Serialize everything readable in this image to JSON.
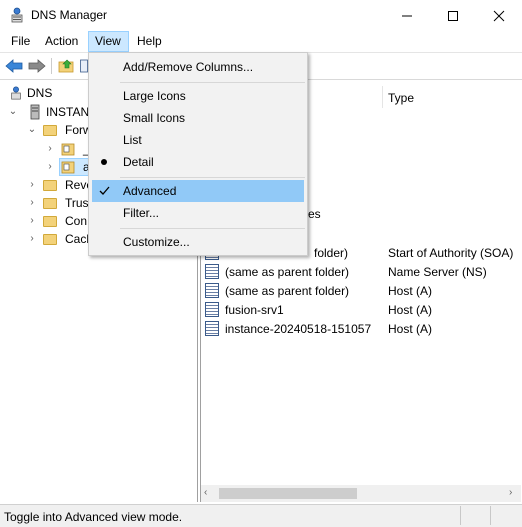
{
  "window": {
    "title": "DNS Manager"
  },
  "menubar": {
    "file": "File",
    "action": "Action",
    "view": "View",
    "help": "Help"
  },
  "view_menu": {
    "add_remove_columns": "Add/Remove Columns...",
    "large_icons": "Large Icons",
    "small_icons": "Small Icons",
    "list": "List",
    "detail": "Detail",
    "advanced": "Advanced",
    "filter": "Filter...",
    "customize": "Customize...",
    "selected_view": "Detail",
    "advanced_checked": true
  },
  "tree": {
    "root": "DNS",
    "server": "INSTANC",
    "forward": "Forw",
    "forward_child_1": "_",
    "forward_child_2": "a",
    "reverse": "Reve",
    "trust": "Trust",
    "conditional": "Con",
    "cached": "Cach"
  },
  "list": {
    "column_type": "Type",
    "partial_es": "es",
    "rows": [
      {
        "name": "(same as parent folder)",
        "type": "Start of Authority (SOA)"
      },
      {
        "name": "(same as parent folder)",
        "type": "Name Server (NS)"
      },
      {
        "name": "(same as parent folder)",
        "type": "Host (A)"
      },
      {
        "name": "fusion-srv1",
        "type": "Host (A)"
      },
      {
        "name": "instance-20240518-151057",
        "type": "Host (A)"
      }
    ],
    "row0_visible_name": "folder)"
  },
  "statusbar": {
    "text": "Toggle into Advanced view mode."
  },
  "icons": {
    "app": "dns-server-icon",
    "back": "back-arrow-icon",
    "forward": "forward-arrow-icon",
    "up": "up-folder-icon",
    "record": "record-icon",
    "folder": "folder-icon"
  },
  "colors": {
    "menu_highlight": "#91c9f7",
    "menu_active": "#cce8ff",
    "folder": "#f3d27a"
  }
}
